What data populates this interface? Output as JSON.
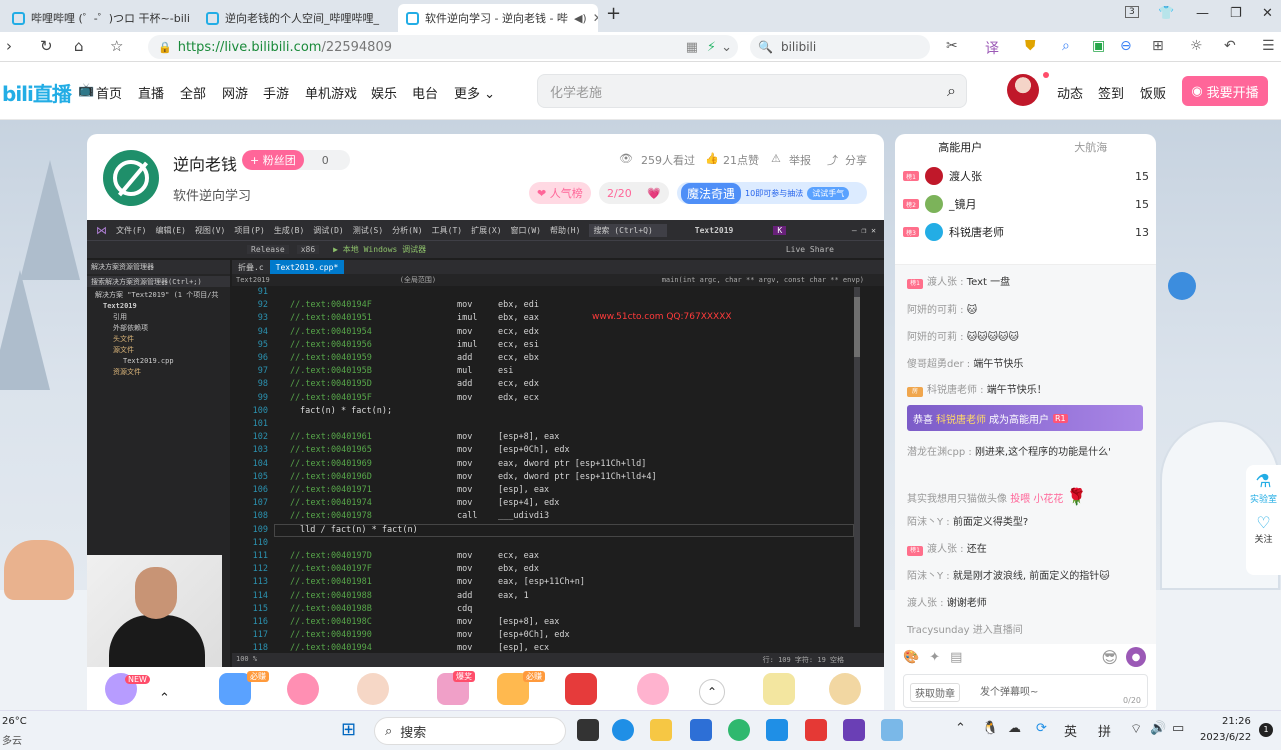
{
  "browser": {
    "tabs": [
      {
        "title": "哔哩哔哩 (゜-゜)つロ 干杯~-bili",
        "active": false
      },
      {
        "title": "逆向老钱的个人空间_哔哩哔哩_",
        "active": false
      },
      {
        "title": "软件逆向学习 - 逆向老钱 - 哔",
        "active": true
      }
    ],
    "tab_count": "3",
    "url_scheme": "https://",
    "url_host": "live.bilibili.com",
    "url_path": "/22594809",
    "search_engine": "bilibili"
  },
  "site_header": {
    "logo": "bili直播",
    "nav": [
      "首页",
      "直播",
      "全部",
      "网游",
      "手游",
      "单机游戏",
      "娱乐",
      "电台",
      "更多"
    ],
    "search_placeholder": "化学老施",
    "user_links": [
      "动态",
      "签到",
      "饭贩"
    ],
    "go_live": "我要开播"
  },
  "room": {
    "anchor": "逆向老钱",
    "fan_club": "+ 粉丝团",
    "fan_count": "0",
    "title": "软件逆向学习",
    "watched": "259人看过",
    "likes": "21点赞",
    "report": "举报",
    "share": "分享",
    "popularity": "人气榜",
    "progress": "2/20",
    "magic": "魔法奇遇",
    "magic_tip": "10即可参与抽法",
    "magic_btn": "试试手气"
  },
  "ide": {
    "menu": [
      "文件(F)",
      "编辑(E)",
      "视图(V)",
      "项目(P)",
      "生成(B)",
      "调试(D)",
      "测试(S)",
      "分析(N)",
      "工具(T)",
      "扩展(X)",
      "窗口(W)",
      "帮助(H)",
      "搜索 (Ctrl+Q)"
    ],
    "window_title": "Text2019",
    "config": "Release",
    "platform": "x86",
    "debugger": "▶ 本地 Windows 调试器",
    "live_share": "Live Share",
    "solution_title": "解决方案资源管理器",
    "solution_search": "搜索解决方案资源管理器(Ctrl+;)",
    "solution_items": [
      "解决方案 \"Text2019\" (1 个项目/共",
      "Text2019",
      "引用",
      "外部依赖项",
      "头文件",
      "源文件",
      "Text2019.cpp",
      "资源文件"
    ],
    "tabs": [
      "折叠.c",
      "Text2019.cpp*"
    ],
    "scope": "(全局范围)",
    "func": "main(int argc, char ** argv, const char ** envp)",
    "project": "Text2019",
    "watermark": "www.51cto.com QQ:767XXXXX",
    "status": "行: 109  字符: 19  空格",
    "zoom": "100 %",
    "lines": [
      {
        "n": "91",
        "a": "",
        "op": "",
        "arg": ""
      },
      {
        "n": "92",
        "a": "//.text:0040194F",
        "op": "mov",
        "arg": "ebx, edi"
      },
      {
        "n": "93",
        "a": "//.text:00401951",
        "op": "imul",
        "arg": "ebx, eax"
      },
      {
        "n": "94",
        "a": "//.text:00401954",
        "op": "mov",
        "arg": "ecx, edx"
      },
      {
        "n": "95",
        "a": "//.text:00401956",
        "op": "imul",
        "arg": "ecx, esi"
      },
      {
        "n": "96",
        "a": "//.text:00401959",
        "op": "add",
        "arg": "ecx, ebx"
      },
      {
        "n": "97",
        "a": "//.text:0040195B",
        "op": "mul",
        "arg": "esi"
      },
      {
        "n": "98",
        "a": "//.text:0040195D",
        "op": "add",
        "arg": "ecx, edx"
      },
      {
        "n": "99",
        "a": "//.text:0040195F",
        "op": "mov",
        "arg": "edx, ecx"
      },
      {
        "n": "100",
        "a": "",
        "op": "",
        "arg": "",
        "src": "fact(n) * fact(n);"
      },
      {
        "n": "101",
        "a": "",
        "op": "",
        "arg": ""
      },
      {
        "n": "102",
        "a": "//.text:00401961",
        "op": "mov",
        "arg": "[esp+8], eax"
      },
      {
        "n": "103",
        "a": "//.text:00401965",
        "op": "mov",
        "arg": "[esp+0Ch], edx"
      },
      {
        "n": "104",
        "a": "//.text:00401969",
        "op": "mov",
        "arg": "eax, dword ptr [esp+11Ch+lld]"
      },
      {
        "n": "105",
        "a": "//.text:0040196D",
        "op": "mov",
        "arg": "edx, dword ptr [esp+11Ch+lld+4]"
      },
      {
        "n": "106",
        "a": "//.text:00401971",
        "op": "mov",
        "arg": "[esp], eax"
      },
      {
        "n": "107",
        "a": "//.text:00401974",
        "op": "mov",
        "arg": "[esp+4], edx"
      },
      {
        "n": "108",
        "a": "//.text:00401978",
        "op": "call",
        "arg": "___udivdi3"
      },
      {
        "n": "109",
        "a": "",
        "op": "",
        "arg": "",
        "src": "lld / fact(n) * fact(n)"
      },
      {
        "n": "110",
        "a": "",
        "op": "",
        "arg": ""
      },
      {
        "n": "111",
        "a": "//.text:0040197D",
        "op": "mov",
        "arg": "ecx, eax"
      },
      {
        "n": "112",
        "a": "//.text:0040197F",
        "op": "mov",
        "arg": "ebx, edx"
      },
      {
        "n": "113",
        "a": "//.text:00401981",
        "op": "mov",
        "arg": "eax, [esp+11Ch+n]"
      },
      {
        "n": "114",
        "a": "//.text:00401988",
        "op": "add",
        "arg": "eax, 1"
      },
      {
        "n": "115",
        "a": "//.text:0040198B",
        "op": "cdq",
        "arg": ""
      },
      {
        "n": "116",
        "a": "//.text:0040198C",
        "op": "mov",
        "arg": "[esp+8], eax"
      },
      {
        "n": "117",
        "a": "//.text:00401990",
        "op": "mov",
        "arg": "[esp+0Ch], edx"
      },
      {
        "n": "118",
        "a": "//.text:00401994",
        "op": "mov",
        "arg": "[esp], ecx"
      }
    ]
  },
  "gifts": {
    "new_badge": "NEW",
    "must": "必赚",
    "hot": "爆奖"
  },
  "rank": {
    "tabs": [
      "高能用户",
      "大航海"
    ],
    "users": [
      {
        "badge": "榜1",
        "name": "渡人张",
        "score": "15"
      },
      {
        "badge": "榜2",
        "name": "_镜月",
        "score": "15"
      },
      {
        "badge": "榜3",
        "name": "科锐唐老师",
        "score": "13"
      }
    ]
  },
  "chat": {
    "messages": [
      {
        "lv": "榜1",
        "user": "渡人张 :",
        "text": "Text 一盘"
      },
      {
        "lv": "",
        "user": "阿妍的可莉 :",
        "text": "🐱"
      },
      {
        "lv": "",
        "user": "阿妍的可莉 :",
        "text": "🐱🐱🐱🐱🐱"
      },
      {
        "lv": "",
        "user": "傻哥超勇der :",
        "text": "端午节快乐"
      },
      {
        "lv": "房",
        "user": "科锐唐老师 :",
        "text": "端午节快乐！"
      }
    ],
    "congrats_prefix": "恭喜",
    "congrats_user": "科锐唐老师",
    "congrats_suffix": "成为高能用户",
    "congrats_badge": "R1",
    "messages2": [
      {
        "lv": "",
        "user": "潜龙在渊cpp :",
        "text": "刚进来,这个程序的功能是什么'"
      },
      {
        "lv": "",
        "user": "其实我想用只猫做头像",
        "text": "投喂 小花花"
      },
      {
        "lv": "",
        "user": "陌沫丶Y :",
        "text": "前面定义得类型?"
      },
      {
        "lv": "榜1",
        "user": "渡人张 :",
        "text": "还在"
      },
      {
        "lv": "",
        "user": "陌沫丶Y :",
        "text": "就是刚才波浪线, 前面定义的指针🐱"
      },
      {
        "lv": "",
        "user": "渡人张 :",
        "text": "谢谢老师"
      },
      {
        "lv": "",
        "user": "Tracysunday",
        "text": "进入直播间"
      }
    ],
    "get_medal": "获取勋章",
    "input_placeholder": "发个弹幕呗~",
    "counter": "0/20"
  },
  "float": {
    "lab": "实验室",
    "follow": "关注"
  },
  "taskbar": {
    "weather_temp": "26°C",
    "weather_desc": "多云",
    "search_label": "搜索",
    "ime_lang": "英",
    "ime_mode": "拼",
    "time": "21:26",
    "date": "2023/6/22",
    "notif": "1"
  },
  "colors": {
    "bili_blue": "#23ade5",
    "bili_pink": "#ff6699",
    "vs_blue": "#007acc"
  }
}
